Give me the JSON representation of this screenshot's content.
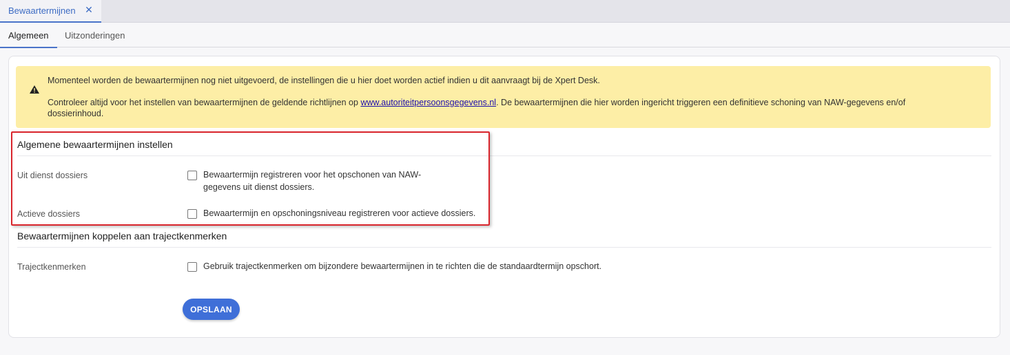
{
  "doc_tab": {
    "label": "Bewaartermijnen",
    "close_icon": "close-icon"
  },
  "subtabs": [
    {
      "label": "Algemeen",
      "active": true
    },
    {
      "label": "Uitzonderingen",
      "active": false
    }
  ],
  "warning": {
    "icon": "warning-icon",
    "line1": "Momenteel worden de bewaartermijnen nog niet uitgevoerd, de instellingen die u hier doet worden actief indien u dit aanvraagt bij de Xpert Desk.",
    "line2_before": "Controleer altijd voor het instellen van bewaartermijnen de geldende richtlijnen op ",
    "line2_link": "www.autoriteitpersoonsgegevens.nl",
    "line2_after": ". De bewaartermijnen die hier worden ingericht triggeren een definitieve schoning van NAW-gegevens en/of",
    "line3": "dossierinhoud."
  },
  "sections": {
    "general": {
      "title": "Algemene bewaartermijnen instellen",
      "fields": [
        {
          "label": "Uit dienst dossiers",
          "checkbox_text_1": "Bewaartermijn registreren voor het opschonen van NAW-",
          "checkbox_text_2": "gegevens uit dienst dossiers.",
          "checked": false
        },
        {
          "label": "Actieve dossiers",
          "checkbox_text_1": "Bewaartermijn en opschoningsniveau registreren voor actieve dossiers.",
          "checked": false
        }
      ]
    },
    "traject": {
      "title": "Bewaartermijnen koppelen aan trajectkenmerken",
      "fields": [
        {
          "label": "Trajectkenmerken",
          "checkbox_text_1": "Gebruik trajectkenmerken om bijzondere bewaartermijnen in te richten die de standaardtermijn opschort.",
          "checked": false
        }
      ]
    }
  },
  "save_button": {
    "label": "OPSLAAN"
  },
  "colors": {
    "accent": "#3f6fd8",
    "warning_bg": "#fdeea6",
    "highlight": "#d9252c"
  }
}
